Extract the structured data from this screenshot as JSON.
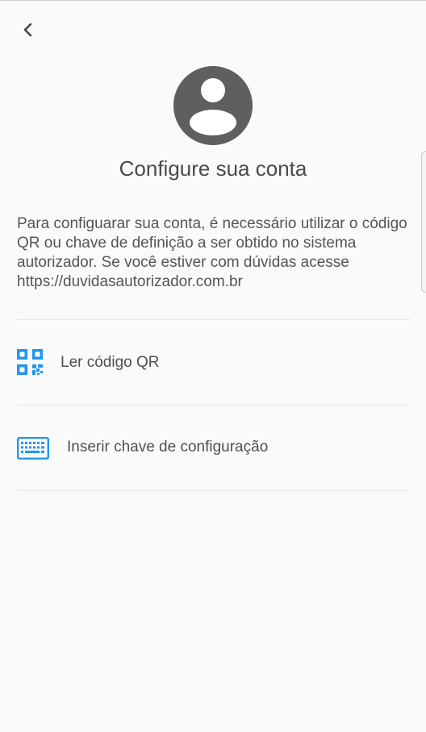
{
  "header": {
    "back_icon": "chevron-left-icon"
  },
  "profile": {
    "avatar_icon": "person-avatar-icon",
    "avatar_color": "#5f5f5f"
  },
  "title": "Configure sua conta",
  "description": "Para configuarar sua conta, é necessário utilizar o código QR ou chave de definição a ser obtido no sistema autorizador. Se você estiver com dúvidas acesse https://duvidasautorizador.com.br",
  "options": [
    {
      "label": "Ler código QR",
      "icon": "qr-code-icon"
    },
    {
      "label": "Inserir chave de configuração",
      "icon": "keyboard-icon"
    }
  ],
  "colors": {
    "accent": "#2196f3",
    "background": "#fafafa",
    "text": "#545454"
  }
}
